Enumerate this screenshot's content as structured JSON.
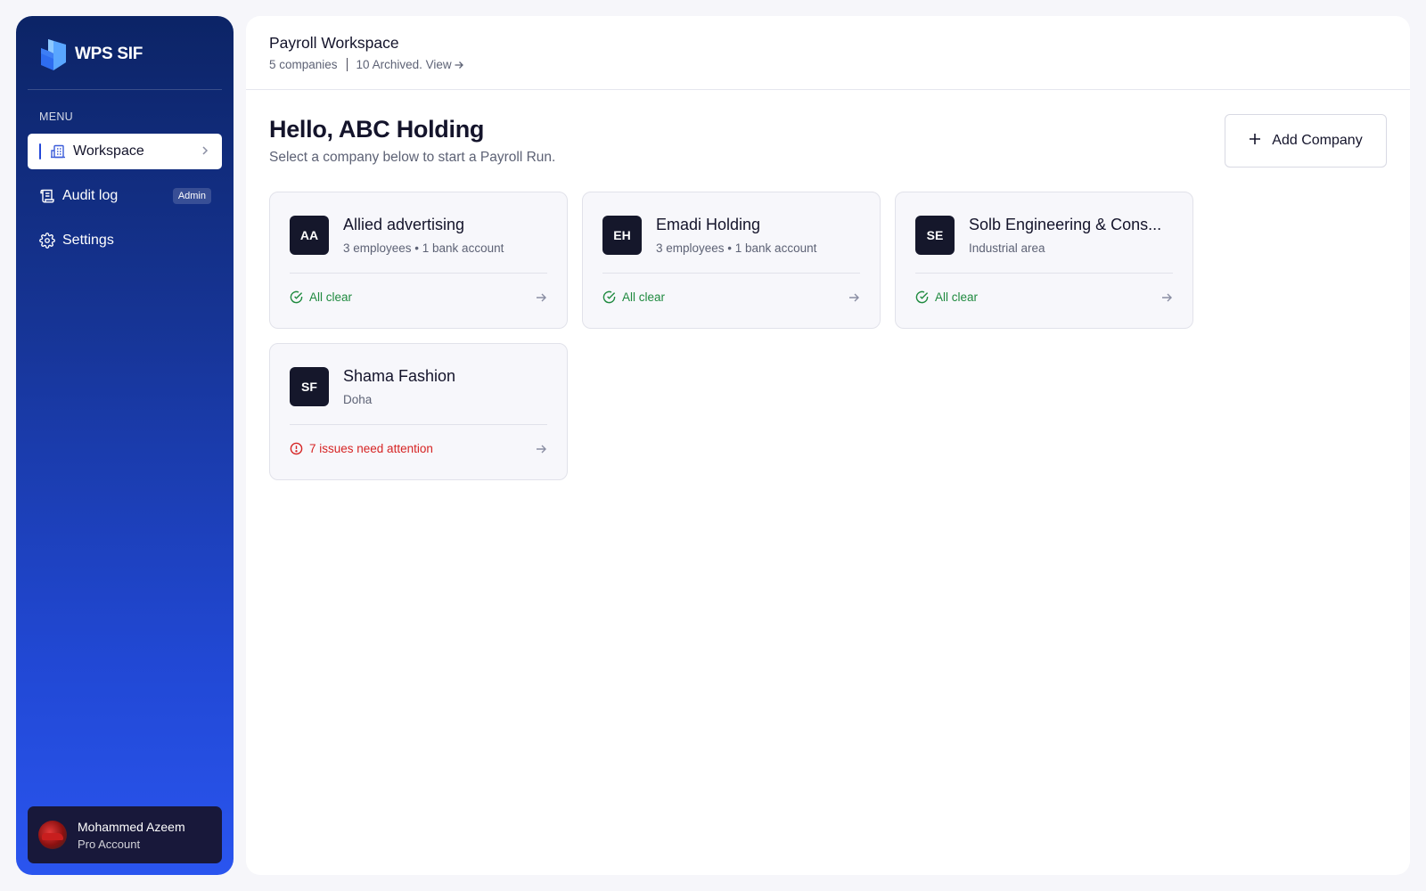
{
  "app": {
    "name": "WPS SIF"
  },
  "sidebar": {
    "menu_label": "MENU",
    "items": [
      {
        "label": "Workspace",
        "icon": "building-icon",
        "active": true
      },
      {
        "label": "Audit log",
        "icon": "scroll-icon",
        "badge": "Admin"
      },
      {
        "label": "Settings",
        "icon": "gear-icon"
      }
    ],
    "user": {
      "name": "Mohammed Azeem",
      "plan": "Pro Account"
    }
  },
  "header": {
    "title": "Payroll Workspace",
    "companies_count": "5 companies",
    "archived_link": "10 Archived. View"
  },
  "main": {
    "greeting": "Hello, ABC Holding",
    "subtitle": "Select a company below to start a Payroll Run.",
    "add_button": "Add Company"
  },
  "companies": [
    {
      "initials": "AA",
      "name": "Allied advertising",
      "meta": "3 employees • 1 bank account",
      "status": "All clear",
      "status_type": "ok"
    },
    {
      "initials": "EH",
      "name": "Emadi Holding",
      "meta": "3 employees • 1 bank account",
      "status": "All clear",
      "status_type": "ok"
    },
    {
      "initials": "SE",
      "name": "Solb Engineering & Cons...",
      "meta": "Industrial area",
      "status": "All clear",
      "status_type": "ok"
    },
    {
      "initials": "SF",
      "name": "Shama Fashion",
      "meta": "Doha",
      "status": "7 issues need attention",
      "status_type": "warn"
    }
  ],
  "colors": {
    "sidebar_top": "#0c2466",
    "sidebar_bottom": "#2a55ef",
    "ok": "#1f8a3f",
    "warn": "#d62323",
    "avatar_bg": "#15172b"
  }
}
